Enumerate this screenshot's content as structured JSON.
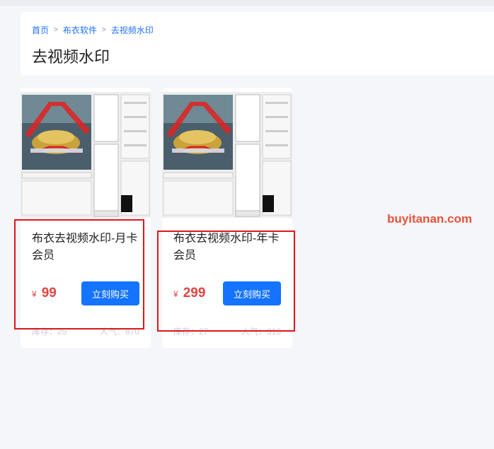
{
  "breadcrumb": {
    "home": "首页",
    "category": "布衣软件",
    "current": "去视频水印",
    "separator": ">"
  },
  "page": {
    "title": "去视频水印"
  },
  "products": [
    {
      "name": "布衣去视频水印-月卡会员",
      "currency": "¥",
      "price": "99",
      "buy_label": "立刻购买",
      "stock_label": "库存：25",
      "popularity_label": "人气：870"
    },
    {
      "name": "布衣去视频水印-年卡会员",
      "currency": "¥",
      "price": "299",
      "buy_label": "立刻购买",
      "stock_label": "库存：27",
      "popularity_label": "人气：316"
    }
  ],
  "watermark": "buyitanan.com",
  "colors": {
    "accent": "#1473ff",
    "price": "#e54343",
    "highlight_box": "#e0161c",
    "watermark": "#e8523a"
  }
}
